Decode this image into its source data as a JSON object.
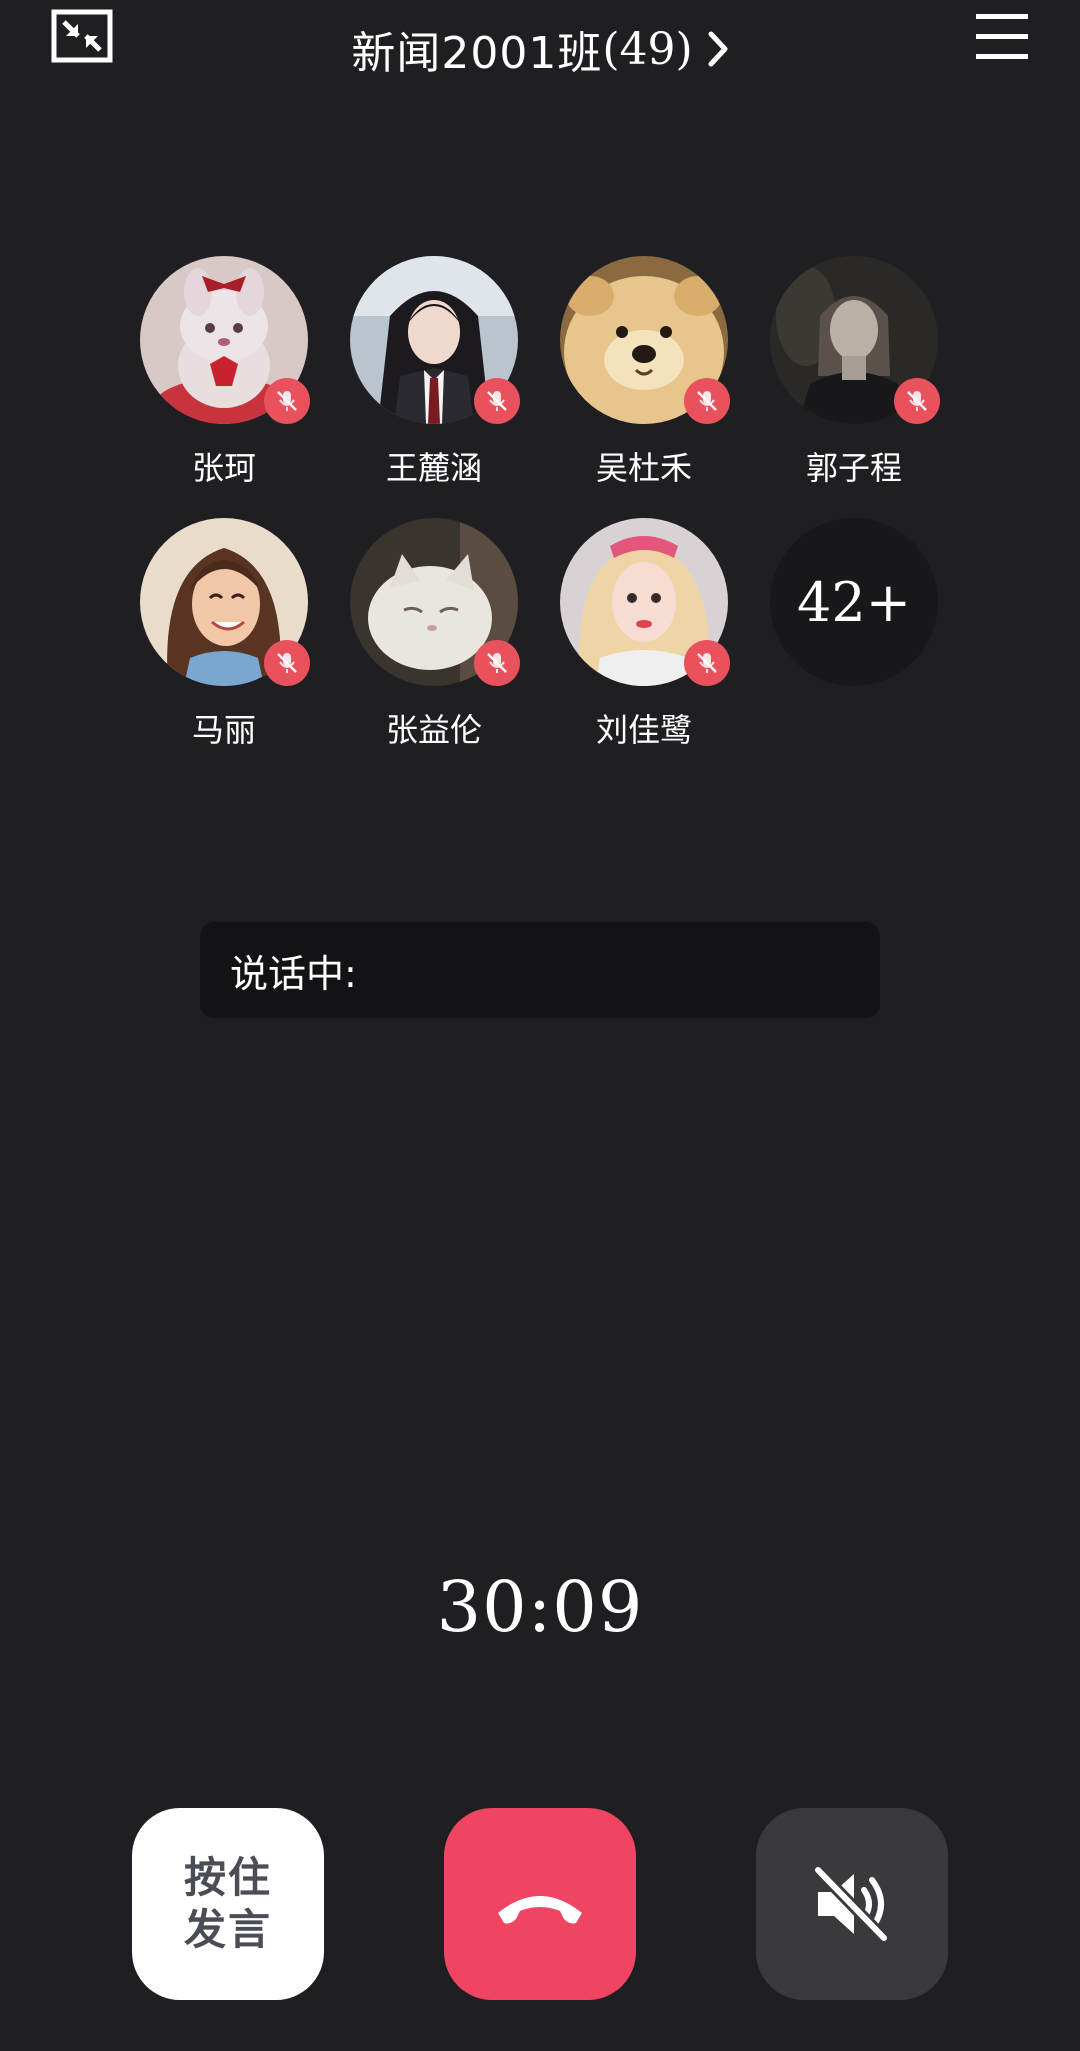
{
  "header": {
    "title": "新闻2001班",
    "count": "(49)",
    "icons": {
      "minimize": "minimize-window-icon",
      "chevron": "chevron-right-icon",
      "menu": "hamburger-menu-icon"
    }
  },
  "members": [
    {
      "name": "张珂",
      "muted": true,
      "avatar": "plush-bunny-avatar"
    },
    {
      "name": "王麓涵",
      "muted": true,
      "avatar": "girl-in-uniform-avatar"
    },
    {
      "name": "吴杜禾",
      "muted": true,
      "avatar": "fluffy-dog-avatar"
    },
    {
      "name": "郭子程",
      "muted": true,
      "avatar": "dark-portrait-avatar"
    },
    {
      "name": "马丽",
      "muted": true,
      "avatar": "cartoon-girl-avatar"
    },
    {
      "name": "张益伦",
      "muted": true,
      "avatar": "white-cat-avatar"
    },
    {
      "name": "刘佳鹭",
      "muted": true,
      "avatar": "blonde-girl-avatar"
    }
  ],
  "more_members": "42+",
  "speaking": {
    "label": "说话中:"
  },
  "timer": "30:09",
  "controls": {
    "push_to_talk": "按住发言",
    "hangup_icon": "phone-hangup-icon",
    "speaker_icon": "speaker-muted-icon"
  },
  "colors": {
    "background": "#1f1f23",
    "mute_badge": "#e9515c",
    "hangup": "#ef4462",
    "speaker_button": "#3a3a3e",
    "ptt_button": "#ffffff"
  }
}
